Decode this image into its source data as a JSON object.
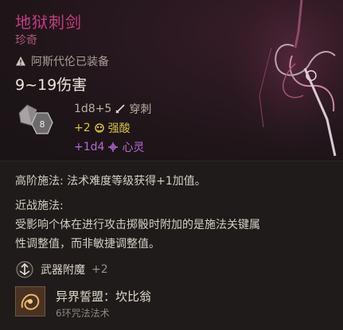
{
  "item": {
    "name": "地狱刺剑",
    "rarity": "珍奇",
    "equipped_note": "阿斯代伦已装备",
    "damage_range": "9~19伤害",
    "dice_label": "8"
  },
  "damage_lines": [
    {
      "text": "1d8+5",
      "type": "穿刺",
      "icon": "rapier-icon",
      "color": "#b8afa6"
    },
    {
      "text": "+2",
      "type": "强酸",
      "icon": "acid-icon",
      "color": "#d9c23b"
    },
    {
      "text": "+1d4",
      "type": "心灵",
      "icon": "psychic-icon",
      "color": "#b76ad2"
    }
  ],
  "properties": {
    "high_casting": "高阶施法: 法术难度等级获得+1加值。",
    "melee_casting_title": "近战施法:",
    "melee_casting_body_1": "受影响个体在进行攻击掷骰时附加的是施法关键属",
    "melee_casting_body_2": "性调整值，而非敏捷调整值。"
  },
  "enchantment": {
    "label": "武器附魔",
    "bonus": "+2"
  },
  "spell": {
    "name": "异界誓盟：坎比翁",
    "subtitle": "6环咒法法术"
  },
  "colors": {
    "title": "#c63b82",
    "rarity": "#b0567d",
    "acid": "#d9c23b",
    "psychic": "#b76ad2"
  }
}
